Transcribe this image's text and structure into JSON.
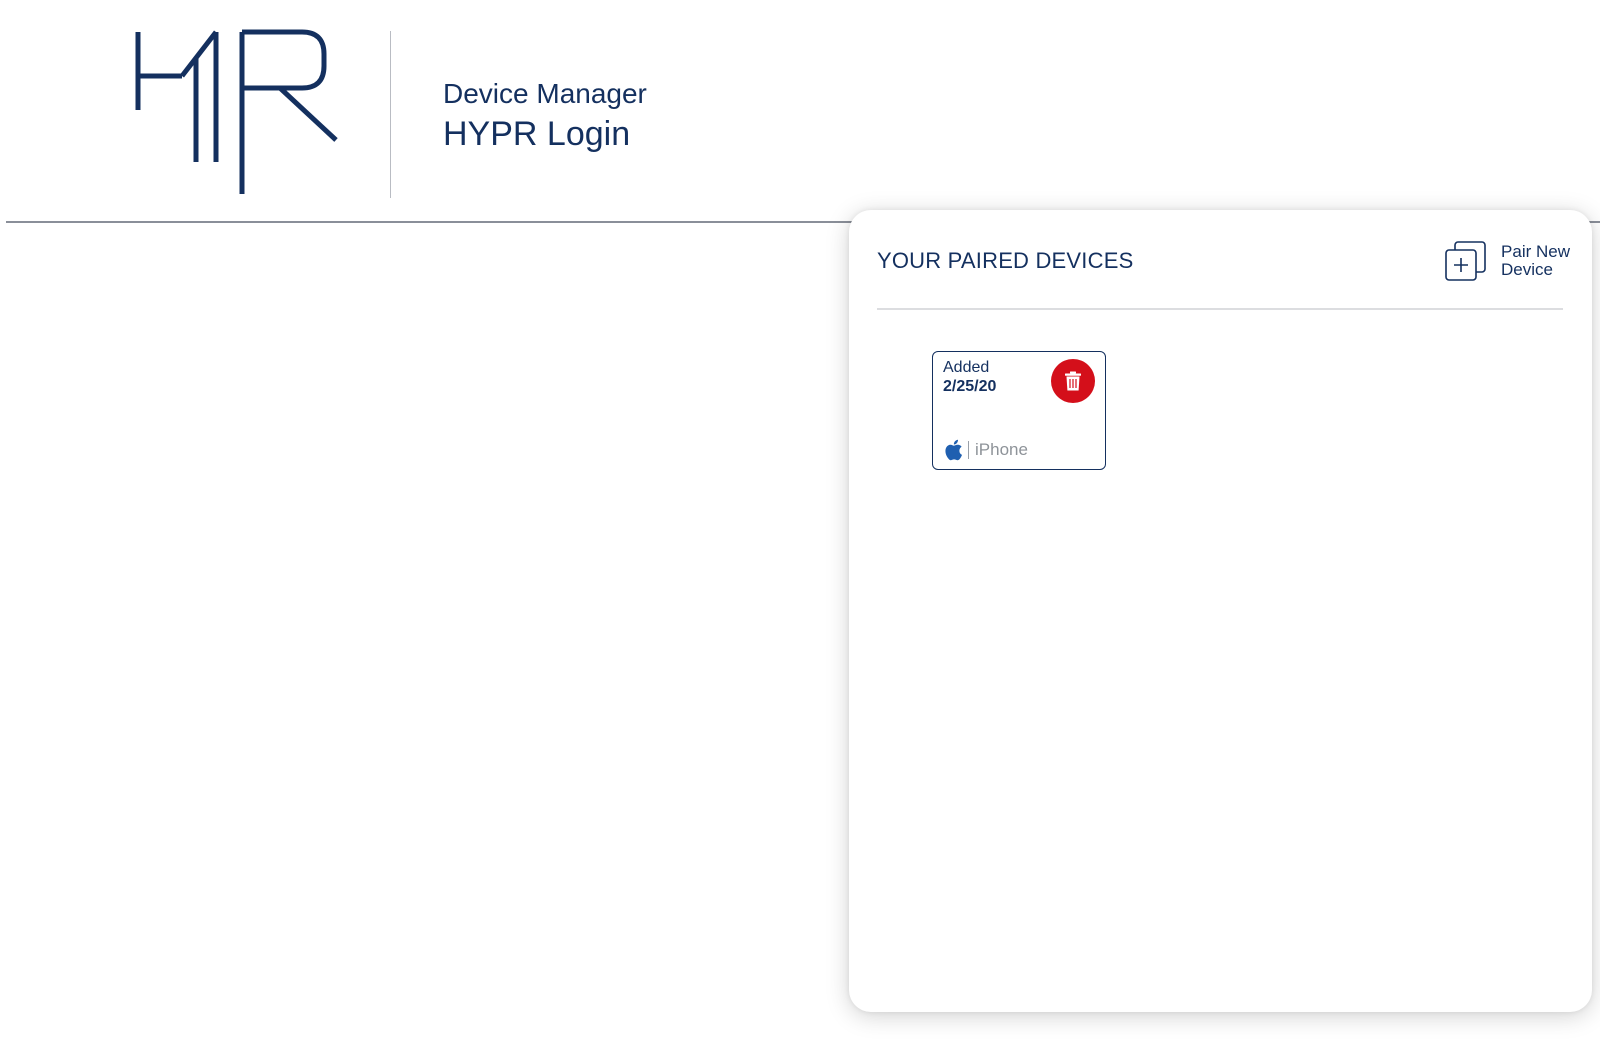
{
  "brand": {
    "logo_name": "HYPR",
    "subtitle": "Device Manager",
    "title": "HYPR Login",
    "color": "#14305f"
  },
  "panel": {
    "title": "YOUR PAIRED DEVICES",
    "pair_button": {
      "label_line1": "Pair New",
      "label_line2": "Device",
      "icon": "pair-device-plus-icon"
    }
  },
  "devices": [
    {
      "added_label": "Added",
      "added_date": "2/25/20",
      "platform_icon": "apple-icon",
      "type": "iPhone",
      "delete_icon": "trash-icon",
      "delete_color": "#d40f1a"
    }
  ]
}
